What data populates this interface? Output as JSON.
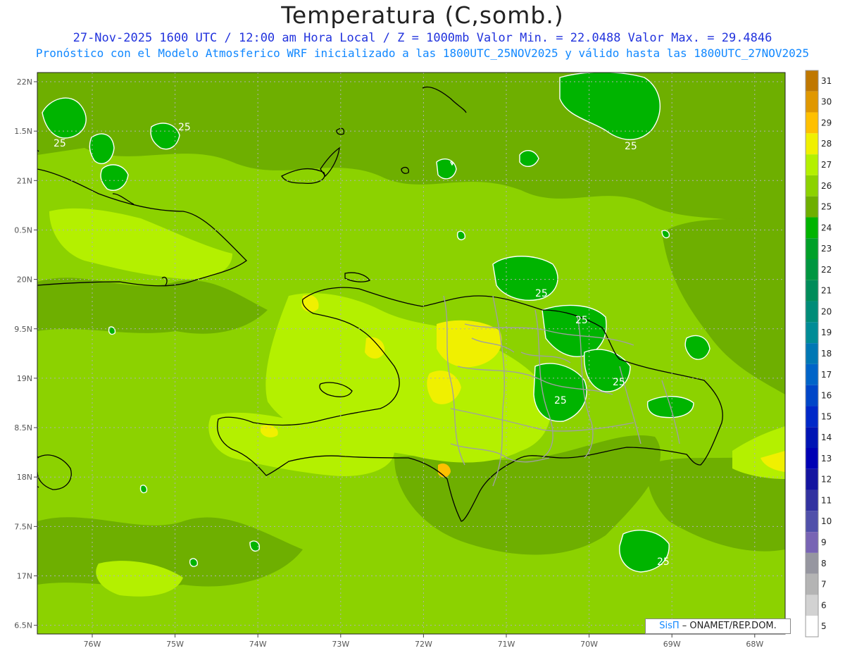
{
  "title": "Temperatura (C,somb.)",
  "subtitle_line1": "27-Nov-2025 1600 UTC / 12:00 am Hora Local / Z = 1000mb  Valor Min. = 22.0488  Valor Max. = 29.4846",
  "subtitle_line2": "Pronóstico con el Modelo Atmosferico WRF inicializado a las 1800UTC_25NOV2025 y válido hasta las  1800UTC_27NOV2025",
  "credit": {
    "brand": "SisΠ",
    "text": " – ONAMET/REP.DOM."
  },
  "map": {
    "lon_range": [
      -76.65,
      -67.6
    ],
    "lat_range": [
      17.6,
      22.1
    ],
    "lat_ticks": [
      {
        "value": 22.0,
        "label": "22N"
      },
      {
        "value": 21.5,
        "label": "1.5N"
      },
      {
        "value": 21.0,
        "label": "21N"
      },
      {
        "value": 20.5,
        "label": "0.5N"
      },
      {
        "value": 20.0,
        "label": "20N"
      },
      {
        "value": 19.5,
        "label": "9.5N"
      },
      {
        "value": 19.0,
        "label": "19N"
      },
      {
        "value": 18.5,
        "label": "8.5N"
      },
      {
        "value": 18.0,
        "label": "18N"
      },
      {
        "value": 17.5,
        "label": "7.5N"
      },
      {
        "value": 17.0,
        "label": "17N"
      },
      {
        "value": 16.5,
        "label": "6.5N"
      }
    ],
    "lon_ticks": [
      {
        "value": -76,
        "label": "76W"
      },
      {
        "value": -75,
        "label": "75W"
      },
      {
        "value": -74,
        "label": "74W"
      },
      {
        "value": -73,
        "label": "73W"
      },
      {
        "value": -72,
        "label": "72W"
      },
      {
        "value": -71,
        "label": "71W"
      },
      {
        "value": -70,
        "label": "70W"
      },
      {
        "value": -69,
        "label": "69W"
      },
      {
        "value": -68,
        "label": "68W"
      }
    ],
    "contour_label": "25"
  },
  "colorbar": {
    "levels": [
      {
        "label": "31",
        "color": "#c07800"
      },
      {
        "label": "30",
        "color": "#e09800"
      },
      {
        "label": "29",
        "color": "#ffc000"
      },
      {
        "label": "28",
        "color": "#f0f000"
      },
      {
        "label": "27",
        "color": "#b4f000"
      },
      {
        "label": "26",
        "color": "#8cd200"
      },
      {
        "label": "25",
        "color": "#6eaf00"
      },
      {
        "label": "24",
        "color": "#00b400"
      },
      {
        "label": "23",
        "color": "#00a028"
      },
      {
        "label": "22",
        "color": "#009640"
      },
      {
        "label": "21",
        "color": "#008c5a"
      },
      {
        "label": "20",
        "color": "#008c78"
      },
      {
        "label": "19",
        "color": "#008c96"
      },
      {
        "label": "18",
        "color": "#0078b4"
      },
      {
        "label": "17",
        "color": "#0064c8"
      },
      {
        "label": "16",
        "color": "#0046c8"
      },
      {
        "label": "15",
        "color": "#0028c8"
      },
      {
        "label": "14",
        "color": "#0014b4"
      },
      {
        "label": "13",
        "color": "#0000b4"
      },
      {
        "label": "12",
        "color": "#1414a0"
      },
      {
        "label": "11",
        "color": "#3232a0"
      },
      {
        "label": "10",
        "color": "#5050aa"
      },
      {
        "label": "9",
        "color": "#7864b4"
      },
      {
        "label": "8",
        "color": "#9696a0"
      },
      {
        "label": "7",
        "color": "#b4b4b4"
      },
      {
        "label": "6",
        "color": "#d2d2d2"
      },
      {
        "label": "5",
        "color": "#ffffff"
      }
    ]
  }
}
